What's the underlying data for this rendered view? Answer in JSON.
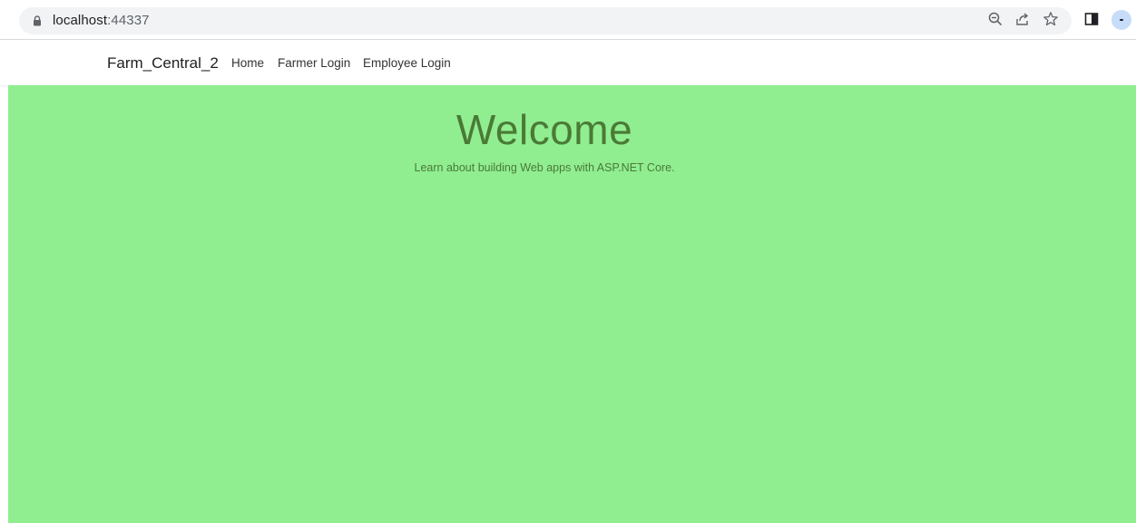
{
  "browser": {
    "url_host": "localhost",
    "url_port": ":44337",
    "icons": [
      "zoom-icon",
      "share-icon",
      "bookmark-star-icon",
      "side-panel-icon",
      "profile-avatar"
    ]
  },
  "navbar": {
    "brand": "Farm_Central_2",
    "links": [
      {
        "label": "Home"
      },
      {
        "label": "Farmer Login"
      },
      {
        "label": "Employee Login"
      }
    ]
  },
  "main": {
    "title": "Welcome",
    "subtitle": "Learn about building Web apps with ASP.NET Core."
  },
  "colors": {
    "content_background": "#90ee90",
    "heading_text": "#4a7a36"
  }
}
